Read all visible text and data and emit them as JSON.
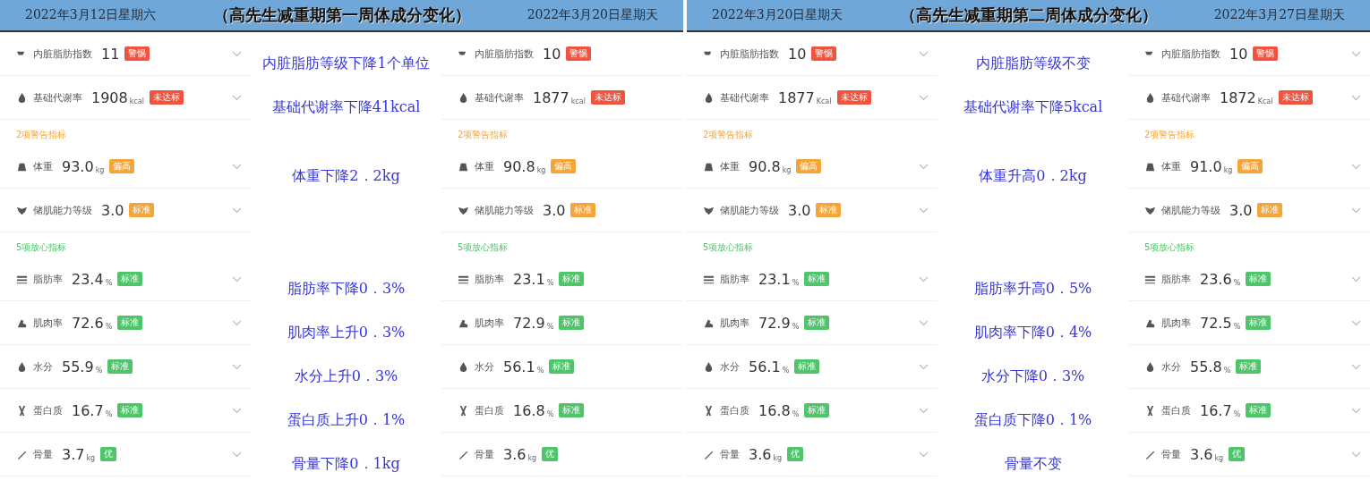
{
  "panels": [
    {
      "dates": [
        "2022年3月12日星期六",
        "2022年3月20日星期天"
      ],
      "title": "（高先生减重期第一周体成分变化）",
      "chevrons": [
        true,
        false
      ],
      "rows": [
        {
          "kind": "metric",
          "cells": [
            {
              "label": "内脏脂肪指数",
              "value": "11",
              "badge": "警惕",
              "color": "#f0533e"
            },
            {
              "label": "内脏脂肪指数",
              "value": "10",
              "badge": "警惕",
              "color": "#f0533e"
            }
          ],
          "note": "内脏脂肪等级下降1个单位"
        },
        {
          "kind": "metric",
          "cells": [
            {
              "label": "基础代谢率",
              "value": "1908",
              "unit": "kcal",
              "badge": "未达标",
              "color": "#f0533e"
            },
            {
              "label": "基础代谢率",
              "value": "1877",
              "unit": "kcal",
              "badge": "未达标",
              "color": "#f0533e"
            }
          ],
          "note": "基础代谢率下降41kcal"
        },
        {
          "kind": "heading",
          "color": "#f4a53a",
          "texts": [
            "2项警告指标",
            "2项警告指标"
          ]
        },
        {
          "kind": "metric",
          "cells": [
            {
              "label": "体重",
              "value": "93.0",
              "unit": "kg",
              "badge": "偏高",
              "color": "#f4a53a"
            },
            {
              "label": "体重",
              "value": "90.8",
              "unit": "kg",
              "badge": "偏高",
              "color": "#f4a53a"
            }
          ],
          "note": "体重下降2．2kg"
        },
        {
          "kind": "metric",
          "cells": [
            {
              "label": "储肌能力等级",
              "value": "3.0",
              "badge": "标准",
              "color": "#f4a53a"
            },
            {
              "label": "储肌能力等级",
              "value": "3.0",
              "badge": "标准",
              "color": "#f4a53a"
            }
          ]
        },
        {
          "kind": "heading",
          "color": "#4fc46a",
          "texts": [
            "5项放心指标",
            "5项放心指标"
          ]
        },
        {
          "kind": "metric",
          "cells": [
            {
              "label": "脂肪率",
              "value": "23.4",
              "unit": "%",
              "badge": "标准",
              "color": "#4fc46a"
            },
            {
              "label": "脂肪率",
              "value": "23.1",
              "unit": "%",
              "badge": "标准",
              "color": "#4fc46a"
            }
          ],
          "note": "脂肪率下降0．3%"
        },
        {
          "kind": "metric",
          "cells": [
            {
              "label": "肌肉率",
              "value": "72.6",
              "unit": "%",
              "badge": "标准",
              "color": "#4fc46a"
            },
            {
              "label": "肌肉率",
              "value": "72.9",
              "unit": "%",
              "badge": "标准",
              "color": "#4fc46a"
            }
          ],
          "note": "肌肉率上升0．3%"
        },
        {
          "kind": "metric",
          "cells": [
            {
              "label": "水分",
              "value": "55.9",
              "unit": "%",
              "badge": "标准",
              "color": "#4fc46a"
            },
            {
              "label": "水分",
              "value": "56.1",
              "unit": "%",
              "badge": "标准",
              "color": "#4fc46a"
            }
          ],
          "note": "水分上升0．3%"
        },
        {
          "kind": "metric",
          "cells": [
            {
              "label": "蛋白质",
              "value": "16.7",
              "unit": "%",
              "badge": "标准",
              "color": "#4fc46a"
            },
            {
              "label": "蛋白质",
              "value": "16.8",
              "unit": "%",
              "badge": "标准",
              "color": "#4fc46a"
            }
          ],
          "note": "蛋白质上升0．1%"
        },
        {
          "kind": "metric",
          "cells": [
            {
              "label": "骨量",
              "value": "3.7",
              "unit": "kg",
              "badge": "优",
              "color": "#4fc46a"
            },
            {
              "label": "骨量",
              "value": "3.6",
              "unit": "kg",
              "badge": "优",
              "color": "#4fc46a"
            }
          ],
          "note": "骨量下降0．1kg"
        }
      ]
    },
    {
      "dates": [
        "2022年3月20日星期天",
        "2022年3月27日星期天"
      ],
      "title": "（高先生减重期第二周体成分变化）",
      "chevrons": [
        true,
        true
      ],
      "rows": [
        {
          "kind": "metric",
          "cells": [
            {
              "label": "内脏脂肪指数",
              "value": "10",
              "badge": "警惕",
              "color": "#f0533e"
            },
            {
              "label": "内脏脂肪指数",
              "value": "10",
              "badge": "警惕",
              "color": "#f0533e"
            }
          ],
          "note": "内脏脂肪等级不变"
        },
        {
          "kind": "metric",
          "cells": [
            {
              "label": "基础代谢率",
              "value": "1877",
              "unit": "Kcal",
              "badge": "未达标",
              "color": "#f0533e"
            },
            {
              "label": "基础代谢率",
              "value": "1872",
              "unit": "Kcal",
              "badge": "未达标",
              "color": "#f0533e"
            }
          ],
          "note": "基础代谢率下降5kcal"
        },
        {
          "kind": "heading",
          "color": "#f4a53a",
          "texts": [
            "2项警告指标",
            "2项警告指标"
          ]
        },
        {
          "kind": "metric",
          "cells": [
            {
              "label": "体重",
              "value": "90.8",
              "unit": "kg",
              "badge": "偏高",
              "color": "#f4a53a"
            },
            {
              "label": "体重",
              "value": "91.0",
              "unit": "kg",
              "badge": "偏高",
              "color": "#f4a53a"
            }
          ],
          "note": "体重升高0．2kg"
        },
        {
          "kind": "metric",
          "cells": [
            {
              "label": "储肌能力等级",
              "value": "3.0",
              "badge": "标准",
              "color": "#f4a53a"
            },
            {
              "label": "储肌能力等级",
              "value": "3.0",
              "badge": "标准",
              "color": "#f4a53a"
            }
          ]
        },
        {
          "kind": "heading",
          "color": "#4fc46a",
          "texts": [
            "5项放心指标",
            "5项放心指标"
          ]
        },
        {
          "kind": "metric",
          "cells": [
            {
              "label": "脂肪率",
              "value": "23.1",
              "unit": "%",
              "badge": "标准",
              "color": "#4fc46a"
            },
            {
              "label": "脂肪率",
              "value": "23.6",
              "unit": "%",
              "badge": "标准",
              "color": "#4fc46a"
            }
          ],
          "note": "脂肪率升高0．5%"
        },
        {
          "kind": "metric",
          "cells": [
            {
              "label": "肌肉率",
              "value": "72.9",
              "unit": "%",
              "badge": "标准",
              "color": "#4fc46a"
            },
            {
              "label": "肌肉率",
              "value": "72.5",
              "unit": "%",
              "badge": "标准",
              "color": "#4fc46a"
            }
          ],
          "note": "肌肉率下降0．4%"
        },
        {
          "kind": "metric",
          "cells": [
            {
              "label": "水分",
              "value": "56.1",
              "unit": "%",
              "badge": "标准",
              "color": "#4fc46a"
            },
            {
              "label": "水分",
              "value": "55.8",
              "unit": "%",
              "badge": "标准",
              "color": "#4fc46a"
            }
          ],
          "note": "水分下降0．3%"
        },
        {
          "kind": "metric",
          "cells": [
            {
              "label": "蛋白质",
              "value": "16.8",
              "unit": "%",
              "badge": "标准",
              "color": "#4fc46a"
            },
            {
              "label": "蛋白质",
              "value": "16.7",
              "unit": "%",
              "badge": "标准",
              "color": "#4fc46a"
            }
          ],
          "note": "蛋白质下降0．1%"
        },
        {
          "kind": "metric",
          "cells": [
            {
              "label": "骨量",
              "value": "3.6",
              "unit": "kg",
              "badge": "优",
              "color": "#4fc46a"
            },
            {
              "label": "骨量",
              "value": "3.6",
              "unit": "kg",
              "badge": "优",
              "color": "#4fc46a"
            }
          ],
          "note": "骨量不变"
        }
      ]
    }
  ]
}
